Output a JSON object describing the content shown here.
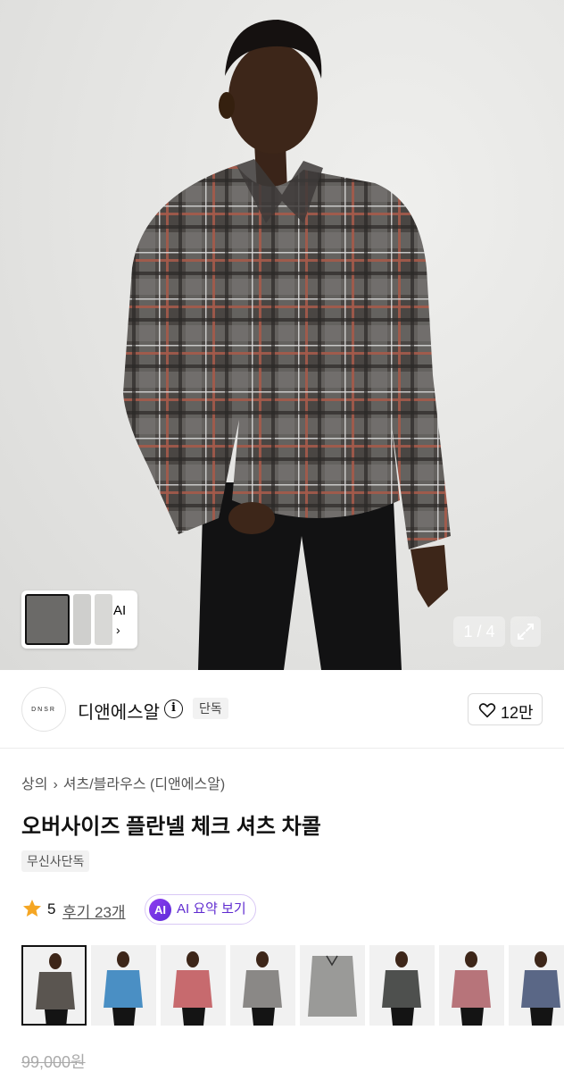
{
  "hero": {
    "image_subject": "model wearing oversized flannel check shirt",
    "counter": "1 / 4",
    "thumb_strip_label": "AI",
    "thumb_strip_chevron": "›",
    "expand_icon": "expand-icon"
  },
  "brand": {
    "logo_text": "DNSR",
    "name": "디앤에스알",
    "info_icon": "i",
    "exclusive_badge": "단독",
    "like_count": "12만"
  },
  "product": {
    "breadcrumb": [
      "상의",
      "셔츠/블라우스 (디앤에스알)"
    ],
    "breadcrumb_sep": "›",
    "title": "오버사이즈 플란넬 체크 셔츠 차콜",
    "tag": "무신사단독",
    "rating": "5",
    "review_link": "후기 23개",
    "ai_badge": "AI",
    "ai_summary": "AI 요약 보기",
    "original_price": "99,000원"
  },
  "color_options": [
    {
      "name": "charcoal",
      "swatch": "#5a5550"
    },
    {
      "name": "blue",
      "swatch": "#4a8fc4"
    },
    {
      "name": "red",
      "swatch": "#c76a6e"
    },
    {
      "name": "grey",
      "swatch": "#8a8886"
    },
    {
      "name": "grey-flat",
      "swatch": "#9a9a98"
    },
    {
      "name": "black-grey",
      "swatch": "#4e504e"
    },
    {
      "name": "red-white",
      "swatch": "#b7747a"
    },
    {
      "name": "navy",
      "swatch": "#5a6786"
    }
  ],
  "colors": {
    "ai_accent": "#6a34db",
    "star": "#f5a623"
  }
}
